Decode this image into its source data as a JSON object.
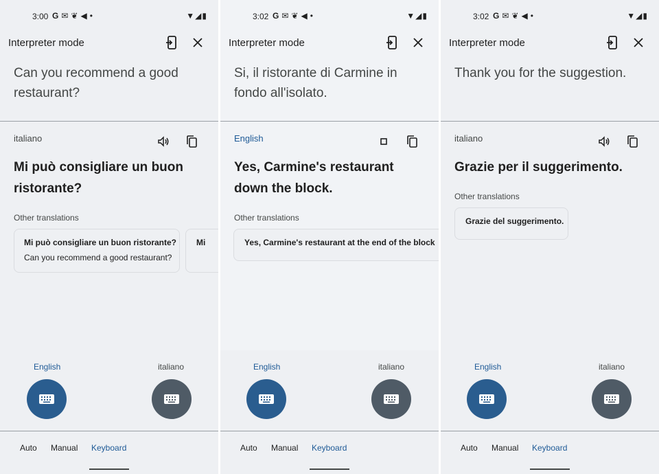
{
  "colors": {
    "accent": "#1e5a96",
    "primary_fab": "#2a5d8f",
    "secondary_fab": "#4f5b66",
    "background": "#eef0f3"
  },
  "screens": [
    {
      "status_time": "3:00",
      "app_title": "Interpreter mode",
      "source_text": "Can you recommend a good restaurant?",
      "result_language": "italiano",
      "translation": "Mi può consigliare un buon ristorante?",
      "other_label": "Other translations",
      "cards": [
        {
          "title": "Mi può consigliare un buon ristorante?",
          "sub": "Can you recommend a good restaurant?"
        },
        {
          "title": "Mi"
        }
      ],
      "left_lang": "English",
      "right_lang": "italiano",
      "tabs": [
        "Auto",
        "Manual",
        "Keyboard"
      ]
    },
    {
      "status_time": "3:02",
      "app_title": "Interpreter mode",
      "source_text": "Si, il ristorante di Carmine in fondo all'isolato.",
      "result_language": "English",
      "translation": "Yes, Carmine's restaurant down the block.",
      "other_label": "Other translations",
      "cards": [
        {
          "title": "Yes, Carmine's restaurant at the end of the block"
        }
      ],
      "left_lang": "English",
      "right_lang": "italiano",
      "tabs": [
        "Auto",
        "Manual",
        "Keyboard"
      ]
    },
    {
      "status_time": "3:02",
      "app_title": "Interpreter mode",
      "source_text": "Thank you for the suggestion.",
      "result_language": "italiano",
      "translation": "Grazie per il suggerimento.",
      "other_label": "Other translations",
      "cards": [
        {
          "title": "Grazie del suggerimento."
        }
      ],
      "left_lang": "English",
      "right_lang": "italiano",
      "tabs": [
        "Auto",
        "Manual",
        "Keyboard"
      ]
    }
  ]
}
